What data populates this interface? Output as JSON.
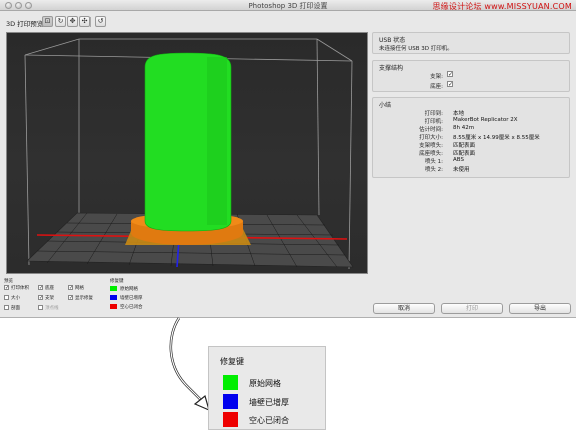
{
  "window": {
    "title": "Photoshop 3D 打印设置",
    "watermark": "思缘设计论坛 www.MISSYUAN.COM"
  },
  "toolbar": {
    "label": "3D 打印预览",
    "icons": [
      "camera-view-icon",
      "rotate-icon",
      "orbit-icon",
      "pan-icon",
      "reset-icon"
    ]
  },
  "usb": {
    "title": "USB 状态",
    "message": "未连接任何 USB 3D 打印机。"
  },
  "support": {
    "title": "支撑结构",
    "items": [
      {
        "label": "支架:",
        "checked": true
      },
      {
        "label": "底座:",
        "checked": true
      }
    ]
  },
  "summary": {
    "title": "小结",
    "rows": [
      {
        "label": "打印到:",
        "value": "本地"
      },
      {
        "label": "打印机:",
        "value": "MakerBot Replicator 2X"
      },
      {
        "label": "估计时间:",
        "value": "8h 42m"
      },
      {
        "label": "打印大小:",
        "value": "8.55厘米 x 14.99厘米 x 8.55厘米"
      },
      {
        "label": "支架喷头:",
        "value": "匹配表面"
      },
      {
        "label": "底座喷头:",
        "value": "匹配表面"
      },
      {
        "label": "喷头 1:",
        "value": "ABS"
      },
      {
        "label": "喷头 2:",
        "value": "未使用"
      }
    ]
  },
  "preview_options": {
    "title": "预览",
    "items": [
      {
        "label": "打印体积",
        "checked": true
      },
      {
        "label": "底座",
        "checked": true
      },
      {
        "label": "网格",
        "checked": true
      },
      {
        "label": "大小",
        "checked": false
      },
      {
        "label": "支架",
        "checked": true
      },
      {
        "label": "显示修复",
        "checked": true
      },
      {
        "label": "剖面",
        "checked": false
      },
      {
        "label": "顶点线",
        "checked": false
      }
    ]
  },
  "repair_legend": {
    "title": "修复键",
    "items": [
      {
        "label": "原始网格",
        "color": "#00ee00"
      },
      {
        "label": "墙壁已增厚",
        "color": "#0000ee"
      },
      {
        "label": "空心已闭合",
        "color": "#ee0000"
      }
    ]
  },
  "buttons": {
    "cancel": "取消",
    "print": "打印",
    "export": "导出"
  },
  "colors": {
    "model_green": "#22dd22",
    "support_orange": "#e07a10",
    "grid_red": "#dd1111",
    "grid_blue": "#2222ee"
  }
}
